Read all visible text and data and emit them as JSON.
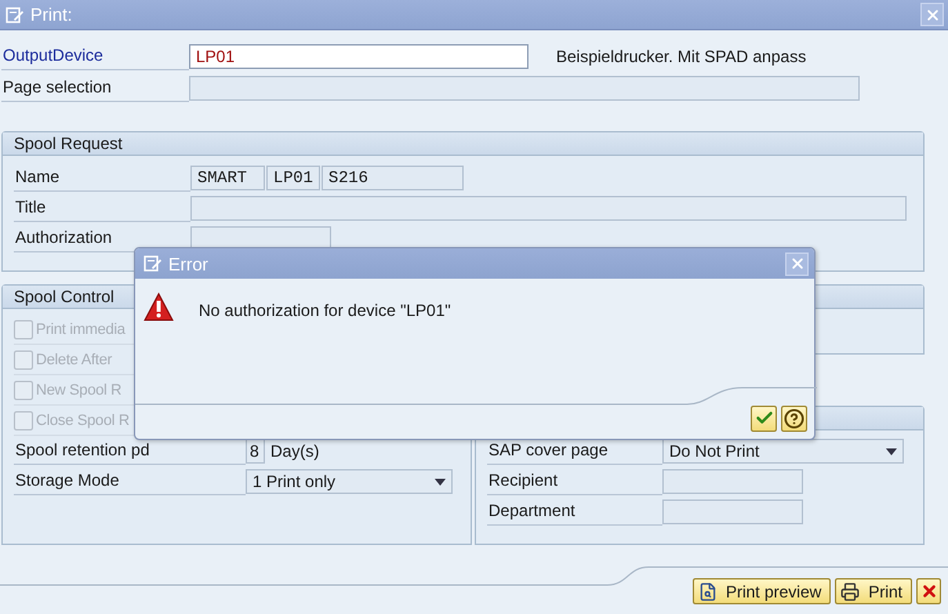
{
  "window": {
    "title": "Print:"
  },
  "output_device": {
    "label": "OutputDevice",
    "value": "LP01",
    "description": "Beispieldrucker. Mit SPAD anpass"
  },
  "page_selection": {
    "label": "Page selection"
  },
  "spool_request": {
    "title": "Spool Request",
    "fields": [
      {
        "label": "Name",
        "values": [
          "SMART",
          "LP01",
          "S216"
        ]
      },
      {
        "label": "Title"
      },
      {
        "label": "Authorization"
      }
    ]
  },
  "spool_control": {
    "title": "Spool Control",
    "checkboxes": [
      {
        "label": "Print immedia",
        "checked": false,
        "disabled": true
      },
      {
        "label": "Delete After",
        "checked": false,
        "disabled": true
      },
      {
        "label": "New Spool R",
        "checked": false,
        "disabled": true
      },
      {
        "label": "Close Spool R",
        "checked": false,
        "disabled": true
      }
    ],
    "retention": {
      "label": "Spool retention pd",
      "value": "8",
      "unit": "Day(s)"
    },
    "storage_mode": {
      "label": "Storage Mode",
      "value": "1 Print only"
    }
  },
  "cover_sheet": {
    "fields": [
      {
        "kind": "dropdown",
        "label": "SAP cover page",
        "value": "Do Not Print"
      },
      {
        "kind": "input",
        "label": "Recipient"
      },
      {
        "kind": "input",
        "label": "Department"
      }
    ]
  },
  "buttons": [
    {
      "kind": "preview",
      "label": "Print preview"
    },
    {
      "kind": "print",
      "label": "Print"
    },
    {
      "kind": "cancel"
    }
  ],
  "dialog": {
    "title": "Error",
    "message": "No authorization for device \"LP01\"",
    "buttons": [
      {
        "kind": "confirm"
      },
      {
        "kind": "help"
      }
    ]
  }
}
